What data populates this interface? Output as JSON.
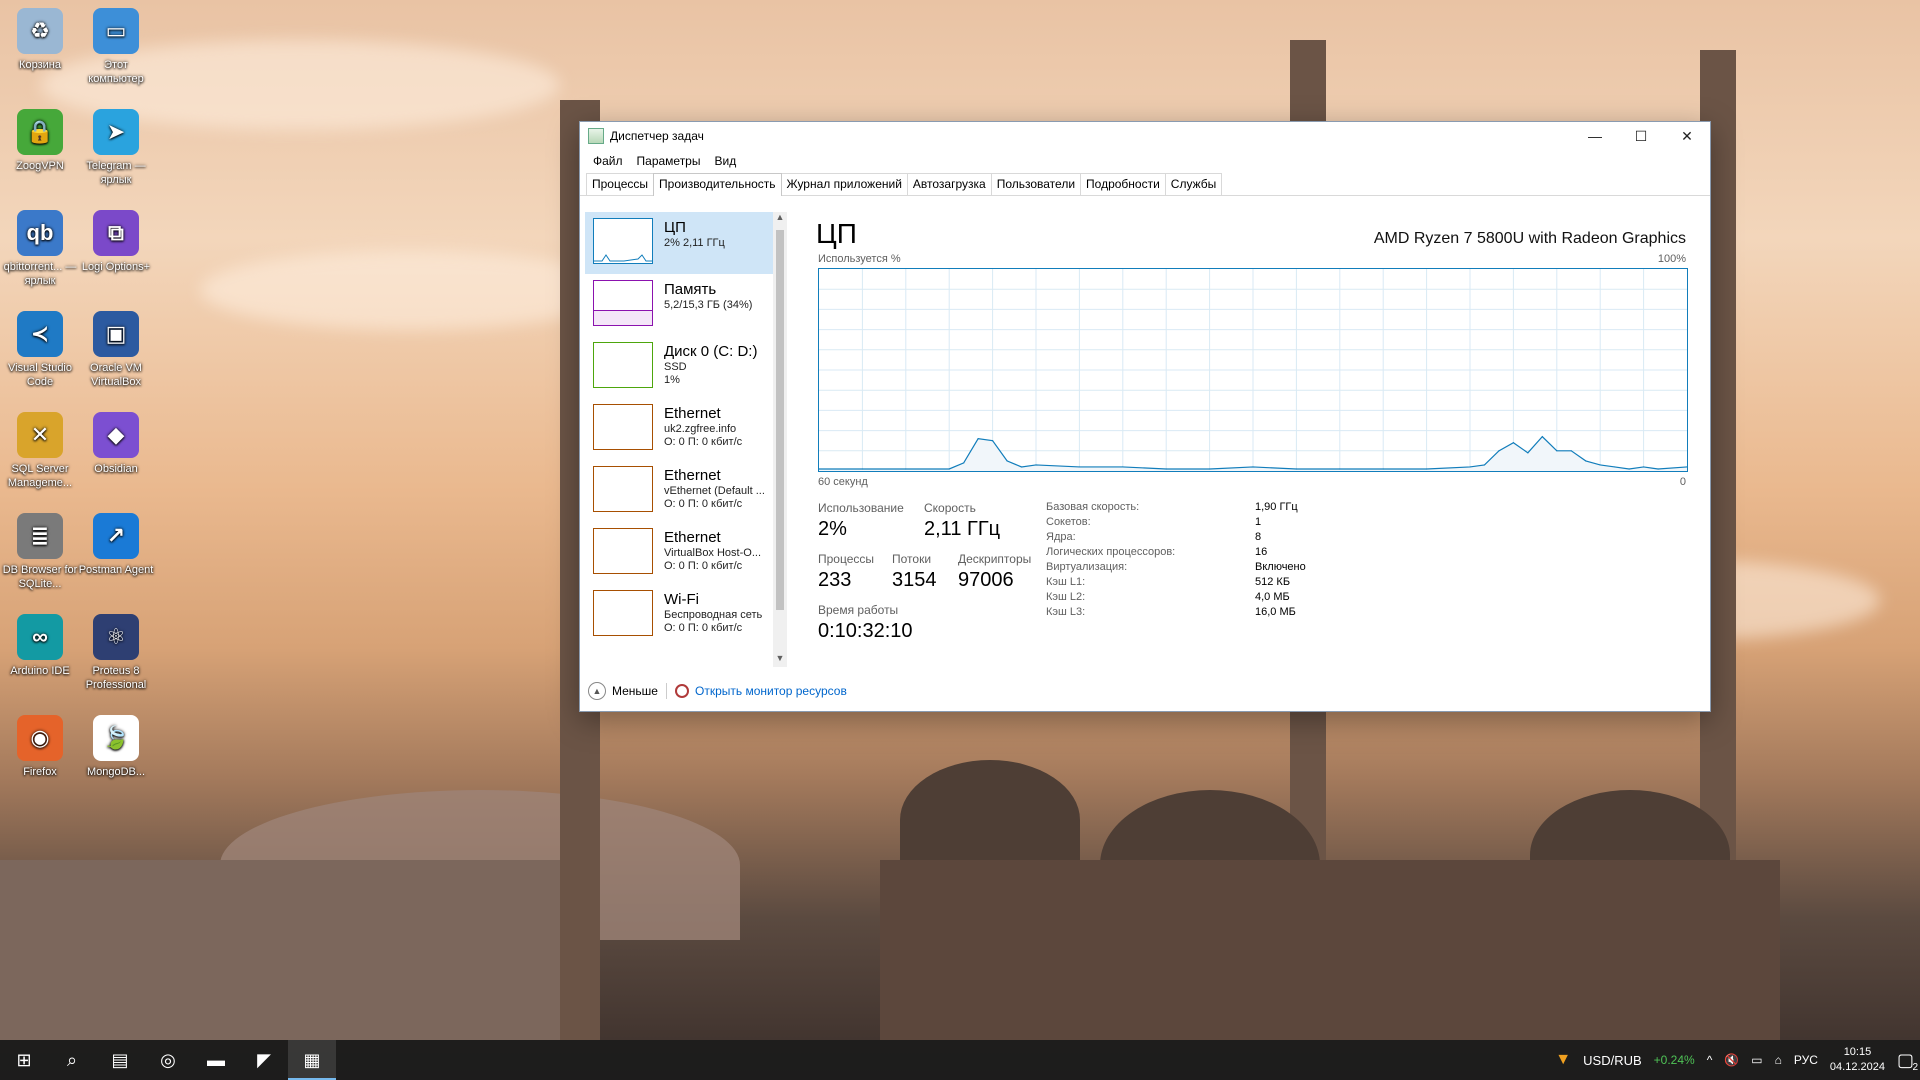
{
  "desktop": {
    "icons": [
      {
        "label": "Корзина",
        "icon": "recycle-bin-icon",
        "color": "#9ab7d3",
        "glyph": "♻"
      },
      {
        "label": "Этот компьютер",
        "icon": "computer-icon",
        "color": "#3d8fd8",
        "glyph": "▭"
      },
      {
        "label": "ZoogVPN",
        "icon": "zoogvpn-icon",
        "color": "#46a83a",
        "glyph": "🔒"
      },
      {
        "label": "Telegram — ярлык",
        "icon": "telegram-icon",
        "color": "#2aa3de",
        "glyph": "➤"
      },
      {
        "label": "qbittorrent... — ярлык",
        "icon": "qbittorrent-icon",
        "color": "#3b79c9",
        "glyph": "qb"
      },
      {
        "label": "Logi Options+",
        "icon": "logi-options-icon",
        "color": "#7b49c9",
        "glyph": "⧉"
      },
      {
        "label": "Visual Studio Code",
        "icon": "vscode-icon",
        "color": "#1f7ac5",
        "glyph": "≺"
      },
      {
        "label": "Oracle VM VirtualBox",
        "icon": "virtualbox-icon",
        "color": "#2c5aa0",
        "glyph": "▣"
      },
      {
        "label": "SQL Server Manageme...",
        "icon": "sql-server-icon",
        "color": "#d9a42b",
        "glyph": "✕"
      },
      {
        "label": "Obsidian",
        "icon": "obsidian-icon",
        "color": "#7c4fd1",
        "glyph": "◆"
      },
      {
        "label": "DB Browser for SQLite...",
        "icon": "db-browser-icon",
        "color": "#7a7a7a",
        "glyph": "≣"
      },
      {
        "label": "Postman Agent",
        "icon": "postman-icon",
        "color": "#1a7ad6",
        "glyph": "↗"
      },
      {
        "label": "Arduino IDE",
        "icon": "arduino-icon",
        "color": "#139aa3",
        "glyph": "∞"
      },
      {
        "label": "Proteus 8 Professional",
        "icon": "proteus-icon",
        "color": "#2e3f72",
        "glyph": "⚛"
      },
      {
        "label": "Firefox",
        "icon": "firefox-icon",
        "color": "#e5632a",
        "glyph": "◉"
      },
      {
        "label": "MongoDB...",
        "icon": "mongodb-icon",
        "color": "#ffffff",
        "glyph": "🍃"
      }
    ]
  },
  "window": {
    "title": "Диспетчер задач",
    "menu": [
      "Файл",
      "Параметры",
      "Вид"
    ],
    "tabs": [
      "Процессы",
      "Производительность",
      "Журнал приложений",
      "Автозагрузка",
      "Пользователи",
      "Подробности",
      "Службы"
    ],
    "active_tab": "Производительность",
    "controls": {
      "minimize": "—",
      "maximize": "☐",
      "close": "✕"
    }
  },
  "sidebar": {
    "items": [
      {
        "title": "ЦП",
        "line1": "2% 2,11 ГГц",
        "line2": "",
        "line3": "",
        "color": "#117dbb"
      },
      {
        "title": "Память",
        "line1": "5,2/15,3 ГБ (34%)",
        "line2": "",
        "line3": "",
        "color": "#8b12ae"
      },
      {
        "title": "Диск 0 (C: D:)",
        "line1": "SSD",
        "line2": "1%",
        "line3": "",
        "color": "#4da60c"
      },
      {
        "title": "Ethernet",
        "line1": "uk2.zgfree.info",
        "line2": "О: 0 П: 0 кбит/с",
        "line3": "",
        "color": "#a74f01"
      },
      {
        "title": "Ethernet",
        "line1": "vEthernet (Default ...",
        "line2": "О: 0 П: 0 кбит/с",
        "line3": "",
        "color": "#a74f01"
      },
      {
        "title": "Ethernet",
        "line1": "VirtualBox Host-O...",
        "line2": "О: 0 П: 0 кбит/с",
        "line3": "",
        "color": "#a74f01"
      },
      {
        "title": "Wi-Fi",
        "line1": "Беспроводная сеть",
        "line2": "О: 0 П: 0 кбит/с",
        "line3": "",
        "color": "#a74f01"
      }
    ]
  },
  "cpu": {
    "title": "ЦП",
    "model": "AMD Ryzen 7 5800U with Radeon Graphics",
    "graph_label": "Используется %",
    "graph_max": "100%",
    "graph_time": "60 секунд",
    "graph_min": "0",
    "stats": {
      "usage_label": "Использование",
      "usage": "2%",
      "speed_label": "Скорость",
      "speed": "2,11 ГГц",
      "processes_label": "Процессы",
      "processes": "233",
      "threads_label": "Потоки",
      "threads": "3154",
      "handles_label": "Дескрипторы",
      "handles": "97006",
      "uptime_label": "Время работы",
      "uptime": "0:10:32:10"
    },
    "specs": [
      {
        "key": "Базовая скорость:",
        "value": "1,90 ГГц"
      },
      {
        "key": "Сокетов:",
        "value": "1"
      },
      {
        "key": "Ядра:",
        "value": "8"
      },
      {
        "key": "Логических процессоров:",
        "value": "16"
      },
      {
        "key": "Виртуализация:",
        "value": "Включено"
      },
      {
        "key": "Кэш L1:",
        "value": "512 КБ"
      },
      {
        "key": "Кэш L2:",
        "value": "4,0 МБ"
      },
      {
        "key": "Кэш L3:",
        "value": "16,0 МБ"
      }
    ]
  },
  "chart_data": {
    "type": "area",
    "x": [
      0,
      3,
      6,
      9,
      10,
      11,
      12,
      13,
      14,
      15,
      18,
      21,
      24,
      27,
      30,
      33,
      36,
      39,
      42,
      45,
      46,
      47,
      48,
      49,
      50,
      51,
      52,
      53,
      54,
      55,
      56,
      57,
      58,
      60
    ],
    "values": [
      1,
      1,
      1,
      1,
      4,
      16,
      15,
      5,
      2,
      3,
      2,
      2,
      1,
      1,
      2,
      1,
      1,
      1,
      1,
      2,
      3,
      10,
      14,
      9,
      17,
      10,
      10,
      5,
      3,
      2,
      1,
      2,
      1,
      2
    ],
    "xlabel": "60 секунд",
    "ylabel": "Используется %",
    "ylim": [
      0,
      100
    ],
    "grid": true
  },
  "footer": {
    "less": "Меньше",
    "monitor": "Открыть монитор ресурсов"
  },
  "taskbar": {
    "items": [
      {
        "icon": "windows-start-icon",
        "glyph": "⊞"
      },
      {
        "icon": "search-icon",
        "glyph": "⌕"
      },
      {
        "icon": "task-view-icon",
        "glyph": "▤"
      },
      {
        "icon": "chrome-icon",
        "glyph": "◎"
      },
      {
        "icon": "file-explorer-icon",
        "glyph": "▬"
      },
      {
        "icon": "visual-studio-icon",
        "glyph": "◤"
      },
      {
        "icon": "task-manager-icon",
        "glyph": "▦"
      }
    ],
    "ticker_label": "USD/RUB",
    "ticker_change": "+0.24%",
    "lang": "РУС",
    "time": "10:15",
    "date": "04.12.2024",
    "notifications": "2"
  }
}
